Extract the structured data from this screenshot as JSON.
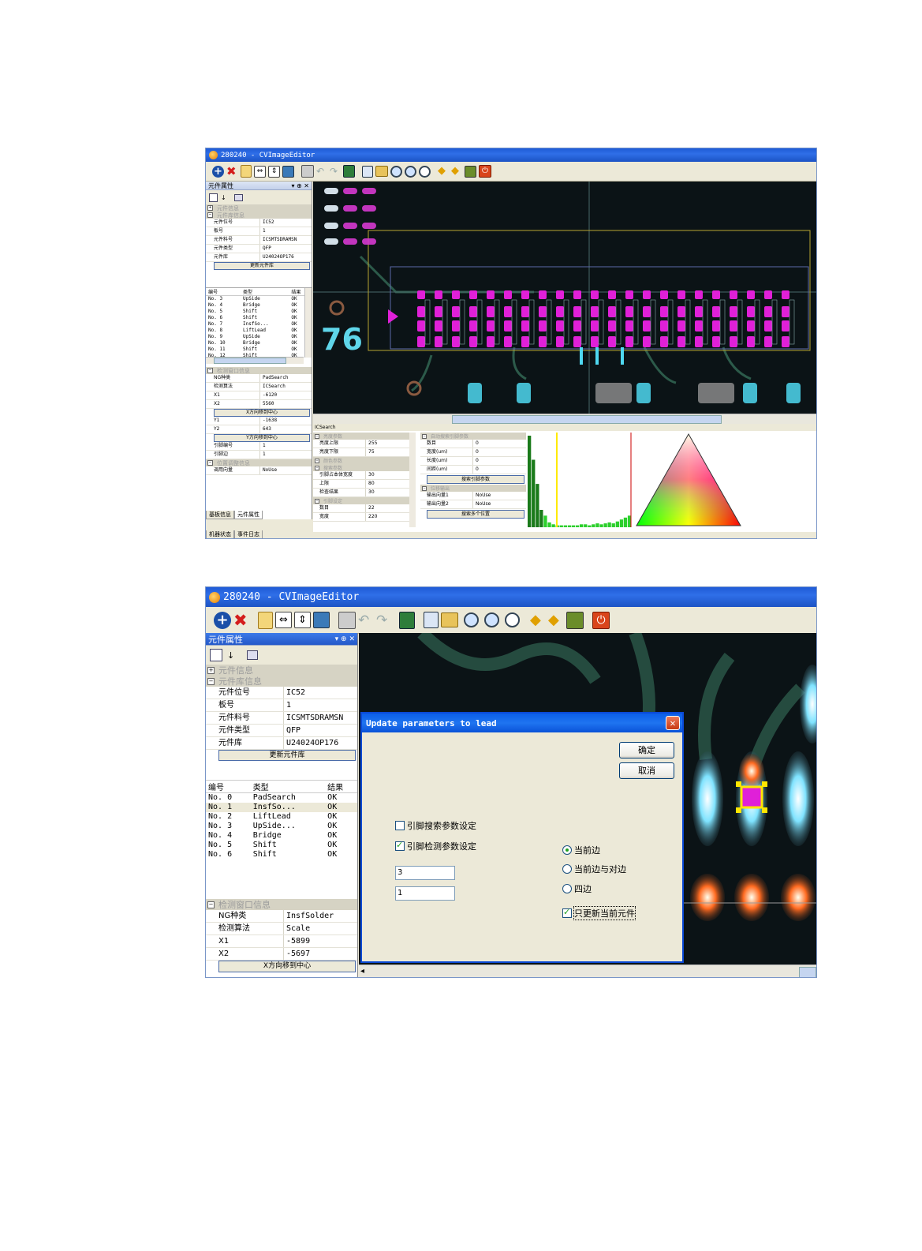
{
  "win1": {
    "title": "280240 - CVImageEditor",
    "panel_title": "元件属性",
    "panel_pin": "▾ ⊕ ✕",
    "sections": {
      "comp_info": "元件信息",
      "lib_info": "元件库信息",
      "win_info": "检测窗口信息",
      "pos_info": "位置调整信息"
    },
    "lib_props": [
      {
        "k": "元件位号",
        "v": "IC52"
      },
      {
        "k": "板号",
        "v": "1"
      },
      {
        "k": "元件料号",
        "v": "ICSMTSDRAMSN"
      },
      {
        "k": "元件类型",
        "v": "QFP"
      },
      {
        "k": "元件库",
        "v": "U24024OP176"
      }
    ],
    "update_lib_btn": "更新元件库",
    "list_headers": [
      "编号",
      "类型",
      "结果"
    ],
    "list_rows": [
      [
        "No. 3",
        "UpSide",
        "OK"
      ],
      [
        "No. 4",
        "Bridge",
        "OK"
      ],
      [
        "No. 5",
        "Shift",
        "OK"
      ],
      [
        "No. 6",
        "Shift",
        "OK"
      ],
      [
        "No. 7",
        "InsfSo...",
        "OK"
      ],
      [
        "No. 8",
        "LiftLead",
        "OK"
      ],
      [
        "No. 9",
        "UpSide",
        "OK"
      ],
      [
        "No. 10",
        "Bridge",
        "OK"
      ],
      [
        "No. 11",
        "Shift",
        "OK"
      ],
      [
        "No. 12",
        "Shift",
        "OK"
      ]
    ],
    "win_props": [
      {
        "k": "NG种类",
        "v": "PadSearch"
      },
      {
        "k": "检测算法",
        "v": "ICSearch"
      },
      {
        "k": "X1",
        "v": "-6120"
      },
      {
        "k": "X2",
        "v": "5560"
      }
    ],
    "x_center_btn": "X方向移到中心",
    "win_props2": [
      {
        "k": "Y1",
        "v": "-1638"
      },
      {
        "k": "Y2",
        "v": "643"
      }
    ],
    "y_center_btn": "Y方向移到中心",
    "win_props3": [
      {
        "k": "引脚编号",
        "v": "1"
      },
      {
        "k": "引脚边",
        "v": "1"
      }
    ],
    "pos_props": [
      {
        "k": "调用向量",
        "v": "NoUse"
      }
    ],
    "tabs_bottom": [
      "基板信息",
      "元件属性"
    ],
    "tabs_bottom2": [
      "机器状态",
      "事件日志"
    ],
    "label_76": "76",
    "algo_title": "ICSearch",
    "param_groups": [
      {
        "name": "亮度参数",
        "rows": [
          [
            "亮度上限",
            "255"
          ],
          [
            "亮度下限",
            "75"
          ]
        ]
      },
      {
        "name": "颜色参数",
        "rows": []
      },
      {
        "name": "搜索参数",
        "rows": [
          [
            "引脚占本体宽度",
            "30"
          ],
          [
            "上限",
            "80"
          ],
          [
            "检查结果",
            "30"
          ]
        ]
      },
      {
        "name": "引脚设定",
        "rows": [
          [
            "数目",
            "22"
          ],
          [
            "宽度",
            "220"
          ]
        ]
      }
    ],
    "auto_group": "自动搜索引脚参数",
    "auto_rows": [
      [
        "数目",
        "0"
      ],
      [
        "宽度(um)",
        "0"
      ],
      [
        "长度(um)",
        "0"
      ],
      [
        "间距(um)",
        "0"
      ]
    ],
    "auto_btn": "搜索引脚参数",
    "vec_group": "位移输出",
    "vec_rows": [
      [
        "输出向量1",
        "NoUse"
      ],
      [
        "输出向量2",
        "NoUse"
      ]
    ],
    "vec_btn": "搜索多个位置",
    "histogram": [
      95,
      70,
      45,
      18,
      12,
      5,
      3,
      2,
      2,
      2,
      2,
      2,
      2,
      3,
      3,
      2,
      3,
      4,
      3,
      4,
      5,
      4,
      6,
      8,
      10,
      12
    ],
    "hist_marker": 0.28
  },
  "win2": {
    "title": "280240 - CVImageEditor",
    "panel_title": "元件属性",
    "panel_pin": "▾ ⊕ ✕",
    "sections": {
      "comp_info": "元件信息",
      "lib_info": "元件库信息",
      "win_info": "检测窗口信息"
    },
    "lib_props": [
      {
        "k": "元件位号",
        "v": "IC52"
      },
      {
        "k": "板号",
        "v": "1"
      },
      {
        "k": "元件料号",
        "v": "ICSMTSDRAMSN"
      },
      {
        "k": "元件类型",
        "v": "QFP"
      },
      {
        "k": "元件库",
        "v": "U24024OP176"
      }
    ],
    "update_lib_btn": "更新元件库",
    "list_headers": [
      "编号",
      "类型",
      "结果"
    ],
    "list_rows": [
      [
        "No. 0",
        "PadSearch",
        "OK"
      ],
      [
        "No. 1",
        "InsfSo...",
        "OK"
      ],
      [
        "No. 2",
        "LiftLead",
        "OK"
      ],
      [
        "No. 3",
        "UpSide...",
        "OK"
      ],
      [
        "No. 4",
        "Bridge",
        "OK"
      ],
      [
        "No. 5",
        "Shift",
        "OK"
      ],
      [
        "No. 6",
        "Shift",
        "OK"
      ]
    ],
    "win_props": [
      {
        "k": "NG种类",
        "v": "InsfSolder"
      },
      {
        "k": "检测算法",
        "v": "Scale"
      },
      {
        "k": "X1",
        "v": "-5899"
      },
      {
        "k": "X2",
        "v": "-5697"
      }
    ],
    "x_center_btn": "X方向移到中心",
    "dialog": {
      "title": "Update parameters to lead",
      "ok": "确定",
      "cancel": "取消",
      "chk_search": "引脚搜索参数设定",
      "chk_detect": "引脚检测参数设定",
      "input1": "3",
      "input2": "1",
      "radio_current": "当前边",
      "radio_opposite": "当前边与对边",
      "radio_four": "四边",
      "chk_only_current": "只更新当前元件"
    }
  },
  "colors": {
    "pad_magenta": "#e020d8",
    "pad_cyan": "#4fd8f0",
    "board": "#0b1316",
    "trace": "#2c5a4a"
  }
}
